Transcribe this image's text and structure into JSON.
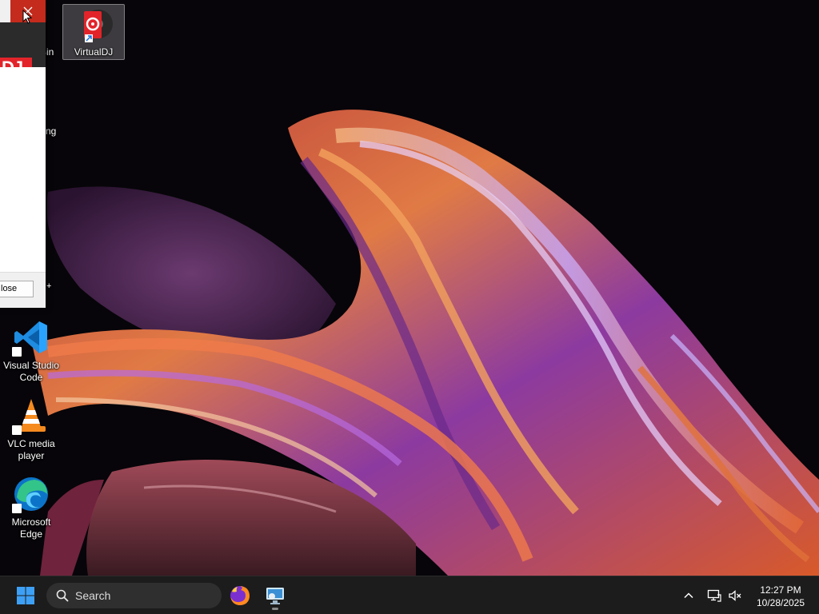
{
  "desktop": {
    "icons": {
      "virtualdj": {
        "label": "VirtualDJ"
      },
      "vscode": {
        "label": "Visual Studio Code"
      },
      "vlc": {
        "label": "VLC media player"
      },
      "edge": {
        "label": "Microsoft Edge"
      }
    },
    "peek": {
      "bin": "Bin",
      "ng": "ng"
    }
  },
  "partial_window": {
    "logo_text": "DJ",
    "close_button_label": "lose"
  },
  "taskbar": {
    "search_placeholder": "Search",
    "apps": [
      "firefox-icon",
      "remote-desktop-icon"
    ],
    "clock": {
      "time": "12:27 PM",
      "date": "10/28/2025"
    }
  },
  "colors": {
    "close_red": "#c42b1c",
    "dj_red": "#e2242a",
    "taskbar": "#1c1c1c"
  }
}
